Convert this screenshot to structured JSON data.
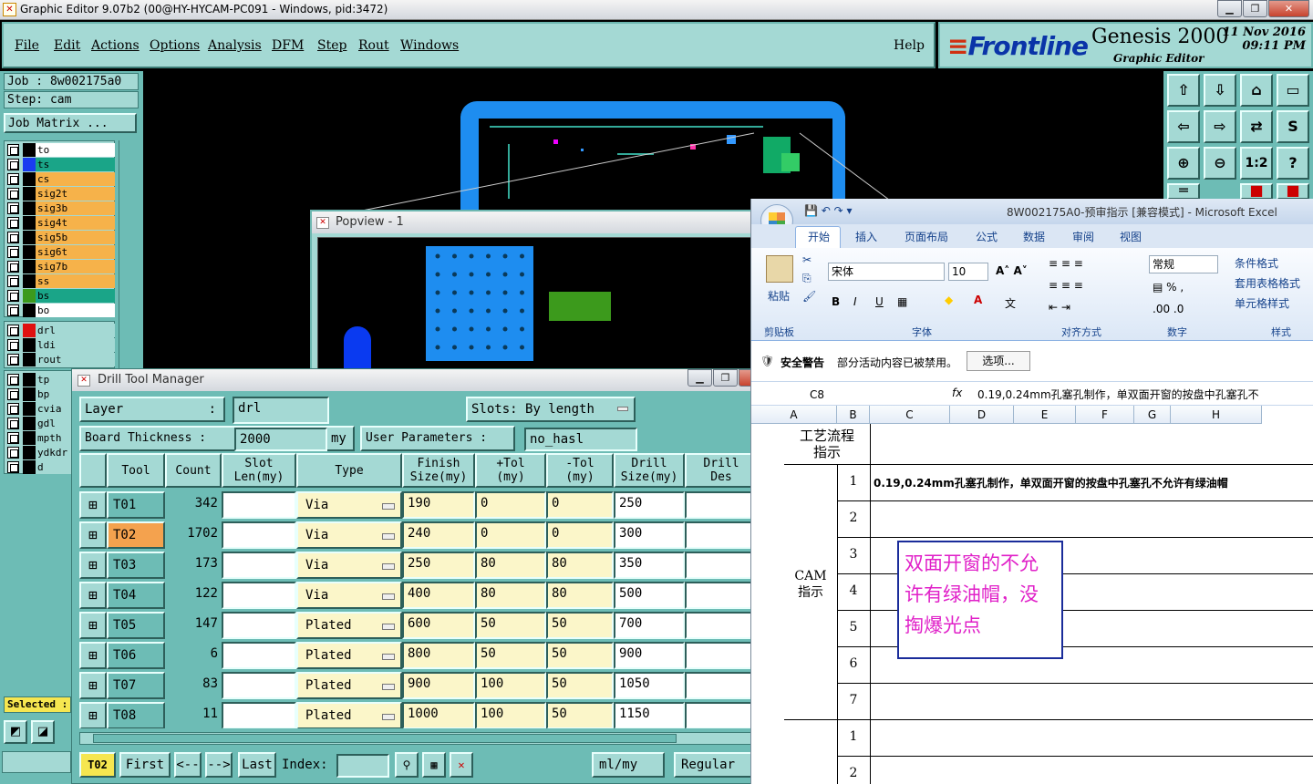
{
  "window": {
    "title": "Graphic Editor 9.07b2 (00@HY-HYCAM-PC091 - Windows, pid:3472)"
  },
  "menu": {
    "items": [
      "File",
      "Edit",
      "Actions",
      "Options",
      "Analysis",
      "DFM",
      "Step",
      "Rout",
      "Windows"
    ],
    "help": "Help"
  },
  "logo": {
    "brand": "Frontline",
    "product": "Genesis 2000",
    "subtitle": "Graphic Editor",
    "date": "11 Nov 2016",
    "time": "09:11 PM"
  },
  "job": {
    "job_label": "Job : 8w002175a0",
    "step_label": "Step: cam",
    "matrix_button": "Job Matrix ..."
  },
  "layers": [
    {
      "name": "to",
      "color": "#ffffff",
      "swatch": "#000000"
    },
    {
      "name": "ts",
      "color": "#1aa588",
      "swatch": "#1a3cf0"
    },
    {
      "name": "cs",
      "color": "#f6b24a",
      "swatch": "#000000"
    },
    {
      "name": "sig2t",
      "color": "#f6b24a",
      "swatch": "#000000"
    },
    {
      "name": "sig3b",
      "color": "#f6b24a",
      "swatch": "#000000"
    },
    {
      "name": "sig4t",
      "color": "#f6b24a",
      "swatch": "#000000"
    },
    {
      "name": "sig5b",
      "color": "#f6b24a",
      "swatch": "#000000"
    },
    {
      "name": "sig6t",
      "color": "#f6b24a",
      "swatch": "#000000"
    },
    {
      "name": "sig7b",
      "color": "#f6b24a",
      "swatch": "#000000"
    },
    {
      "name": "ss",
      "color": "#f6b24a",
      "swatch": "#000000"
    },
    {
      "name": "bs",
      "color": "#1aa588",
      "swatch": "#3c9a1c"
    },
    {
      "name": "bo",
      "color": "#ffffff",
      "swatch": "#000000"
    }
  ],
  "layers2": [
    {
      "name": "drl",
      "color": "#a4d9d4",
      "swatch": "#e01010"
    },
    {
      "name": "ldi",
      "color": "#a4d9d4",
      "swatch": "#000000"
    },
    {
      "name": "rout",
      "color": "#a4d9d4",
      "swatch": "#000000"
    }
  ],
  "layers3": [
    {
      "name": "tp"
    },
    {
      "name": "bp"
    },
    {
      "name": "cvia"
    },
    {
      "name": "gdl"
    },
    {
      "name": "mpth"
    },
    {
      "name": "ydkdr"
    },
    {
      "name": "d"
    }
  ],
  "selected_label": "Selected :",
  "popview": {
    "title": "Popview - 1"
  },
  "dtm": {
    "title": "Drill Tool Manager",
    "layer_label": "Layer",
    "layer_colon": ":",
    "layer_value": "drl",
    "slots_label": "Slots:",
    "slots_value": "By length",
    "thickness_label": "Board Thickness :",
    "thickness_value": "2000",
    "thickness_unit": "my",
    "user_params_label": "User Parameters :",
    "user_params_value": "no_hasl",
    "headers": [
      "Tool",
      "Count",
      "Slot\nLen(my)",
      "Type",
      "Finish\nSize(my)",
      "+Tol\n(my)",
      "-Tol\n(my)",
      "Drill\nSize(my)",
      "Drill\nDes"
    ],
    "rows": [
      {
        "tool": "T01",
        "count": "342",
        "type": "Via",
        "finish": "190",
        "ptol": "0",
        "ntol": "0",
        "drill": "250"
      },
      {
        "tool": "T02",
        "count": "1702",
        "type": "Via",
        "finish": "240",
        "ptol": "0",
        "ntol": "0",
        "drill": "300"
      },
      {
        "tool": "T03",
        "count": "173",
        "type": "Via",
        "finish": "250",
        "ptol": "80",
        "ntol": "80",
        "drill": "350"
      },
      {
        "tool": "T04",
        "count": "122",
        "type": "Via",
        "finish": "400",
        "ptol": "80",
        "ntol": "80",
        "drill": "500"
      },
      {
        "tool": "T05",
        "count": "147",
        "type": "Plated",
        "finish": "600",
        "ptol": "50",
        "ntol": "50",
        "drill": "700"
      },
      {
        "tool": "T06",
        "count": "6",
        "type": "Plated",
        "finish": "800",
        "ptol": "50",
        "ntol": "50",
        "drill": "900"
      },
      {
        "tool": "T07",
        "count": "83",
        "type": "Plated",
        "finish": "900",
        "ptol": "100",
        "ntol": "50",
        "drill": "1050"
      },
      {
        "tool": "T08",
        "count": "11",
        "type": "Plated",
        "finish": "1000",
        "ptol": "100",
        "ntol": "50",
        "drill": "1150"
      }
    ],
    "selected_tool": "T02",
    "first": "First",
    "prev": "<--",
    "next": "-->",
    "last": "Last",
    "index_label": "Index:",
    "units": "ml/my",
    "mode": "Regular"
  },
  "excel": {
    "title": "8W002175A0-预审指示  [兼容模式] - Microsoft Excel",
    "tabs": [
      "开始",
      "插入",
      "页面布局",
      "公式",
      "数据",
      "审阅",
      "视图"
    ],
    "paste": "粘贴",
    "font_name": "宋体",
    "font_size": "10",
    "number_format": "常规",
    "cond_format": "条件格式",
    "table_format": "套用表格格式",
    "cell_style": "单元格样式",
    "groups": [
      "剪贴板",
      "字体",
      "对齐方式",
      "数字",
      "样式"
    ],
    "security_warning": "安全警告",
    "security_text": "部分活动内容已被禁用。",
    "options_button": "选项...",
    "name_box": "C8",
    "fx": "fx",
    "formula": "0.19,0.24mm孔塞孔制作，单双面开窗的按盘中孔塞孔不",
    "columns": [
      "A",
      "B",
      "C",
      "D",
      "E",
      "F",
      "G",
      "H"
    ],
    "process_title_1": "工艺流程",
    "process_title_2": "指示",
    "cam_1": "CAM",
    "cam_2": "指示",
    "row1_text": "0.19,0.24mm孔塞孔制作，单双面开窗的按盘中孔塞孔不允许有绿油帽",
    "row_numbers": [
      "1",
      "2",
      "3",
      "4",
      "5",
      "6",
      "7"
    ],
    "row_numbers_2": [
      "1",
      "2"
    ],
    "note": "双面开窗的不允许有绿油帽，没掏爆光点"
  }
}
